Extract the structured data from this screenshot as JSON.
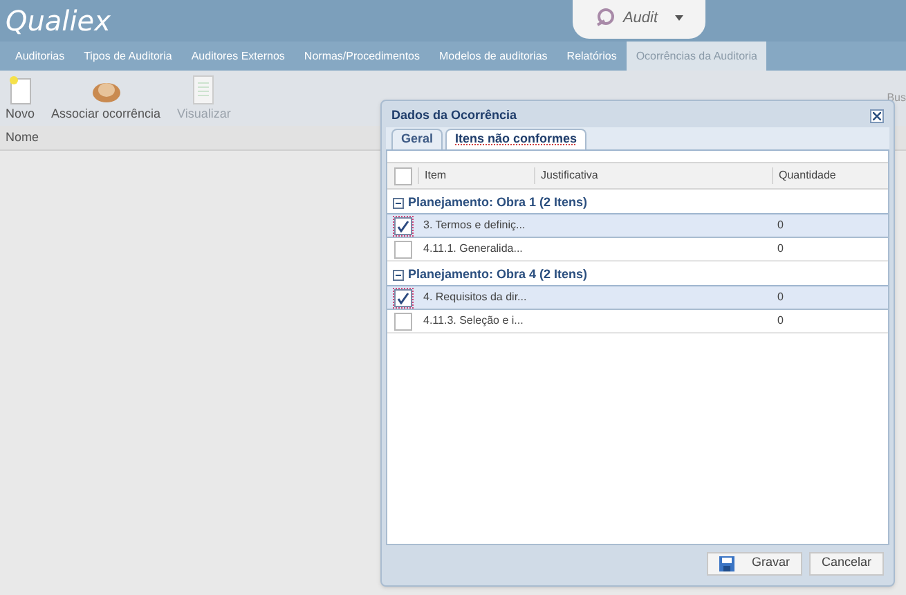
{
  "header": {
    "logo": "Qualiex",
    "module": "Audit"
  },
  "nav": [
    {
      "label": "Auditorias",
      "selected": false
    },
    {
      "label": "Tipos de Auditoria",
      "selected": false
    },
    {
      "label": "Auditores Externos",
      "selected": false
    },
    {
      "label": "Normas/Procedimentos",
      "selected": false
    },
    {
      "label": "Modelos de auditorias",
      "selected": false
    },
    {
      "label": "Relatórios",
      "selected": false
    },
    {
      "label": "Ocorrências da Auditoria",
      "selected": true
    }
  ],
  "toolbar": [
    {
      "label": "Novo",
      "kind": "new",
      "disabled": false
    },
    {
      "label": "Associar ocorrência",
      "kind": "associate",
      "disabled": false
    },
    {
      "label": "Visualizar",
      "kind": "view",
      "disabled": true
    }
  ],
  "search_label": "Bus",
  "list": {
    "columns": [
      "Nome"
    ]
  },
  "dialog": {
    "title": "Dados da Ocorrência",
    "tabs": [
      {
        "label": "Geral",
        "selected": false
      },
      {
        "label": "Itens não conformes",
        "selected": true
      }
    ],
    "table": {
      "select_all": false,
      "columns": [
        "Item",
        "Justificativa",
        "Quantidade"
      ],
      "groups": [
        {
          "title": "Planejamento: Obra 1 (2 Itens)",
          "expanded": true,
          "rows": [
            {
              "item": "3. Termos e definiç...",
              "justificativa": "",
              "quantidade": "0",
              "checked": true
            },
            {
              "item": "4.11.1. Generalida...",
              "justificativa": "",
              "quantidade": "0",
              "checked": false
            }
          ]
        },
        {
          "title": "Planejamento: Obra 4 (2 Itens)",
          "expanded": true,
          "rows": [
            {
              "item": "4. Requisitos da dir...",
              "justificativa": "",
              "quantidade": "0",
              "checked": true
            },
            {
              "item": "4.11.3. Seleção e i...",
              "justificativa": "",
              "quantidade": "0",
              "checked": false
            }
          ]
        }
      ]
    },
    "buttons": [
      {
        "label": "Gravar",
        "kind": "save"
      },
      {
        "label": "Cancelar",
        "kind": "cancel"
      }
    ]
  }
}
